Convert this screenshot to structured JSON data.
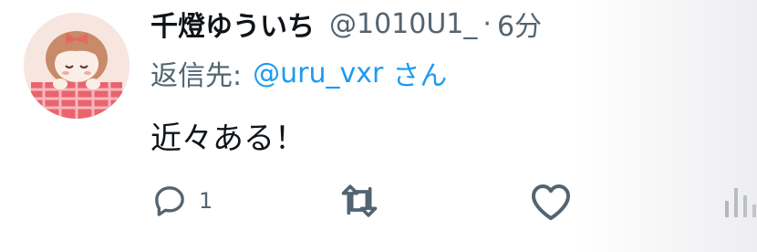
{
  "tweet": {
    "display_name": "千燈ゆういち",
    "handle": "@1010U1_",
    "separator": "·",
    "time": "6分",
    "reply_label": "返信先:",
    "reply_user": "@uru_vxr",
    "reply_suffix": "さん",
    "text": "近々ある！",
    "reply_count": "1"
  },
  "icons": {
    "reply": "reply-icon",
    "retweet": "retweet-icon",
    "like": "heart-icon",
    "views": "views-icon"
  },
  "colors": {
    "name": "#0f1419",
    "secondary": "#536471",
    "link": "#1d9bf0"
  }
}
